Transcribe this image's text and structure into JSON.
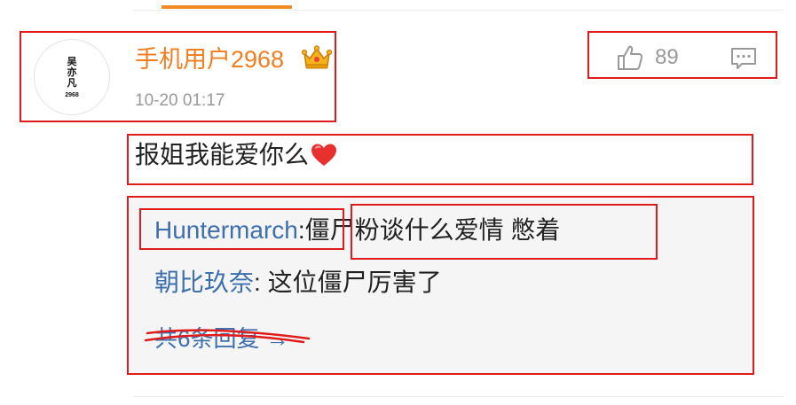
{
  "colors": {
    "accent": "#f08a24",
    "username": "#f07e1f",
    "link": "#3e6fae",
    "muted": "#999999",
    "annotation": "#e01b1b",
    "reply_bg": "#f5f5f5"
  },
  "comment": {
    "avatar": {
      "name_text": "吴亦凡",
      "number_text": "2968"
    },
    "author": "手机用户2968",
    "badge_icon": "crown-icon",
    "timestamp": "10-20 01:17",
    "like_count": "89",
    "like_icon": "thumbs-up-icon",
    "reply_icon": "comment-icon",
    "text": "报姐我能爱你么",
    "emoji_icon": "heart-icon"
  },
  "replies": [
    {
      "user": "Huntermarch",
      "separator": ":",
      "text": "僵尸粉谈什么爱情 憋着"
    },
    {
      "user": "朝比玖奈",
      "separator": ":",
      "text": "这位僵尸厉害了"
    }
  ],
  "more_replies": "共6条回复 →"
}
